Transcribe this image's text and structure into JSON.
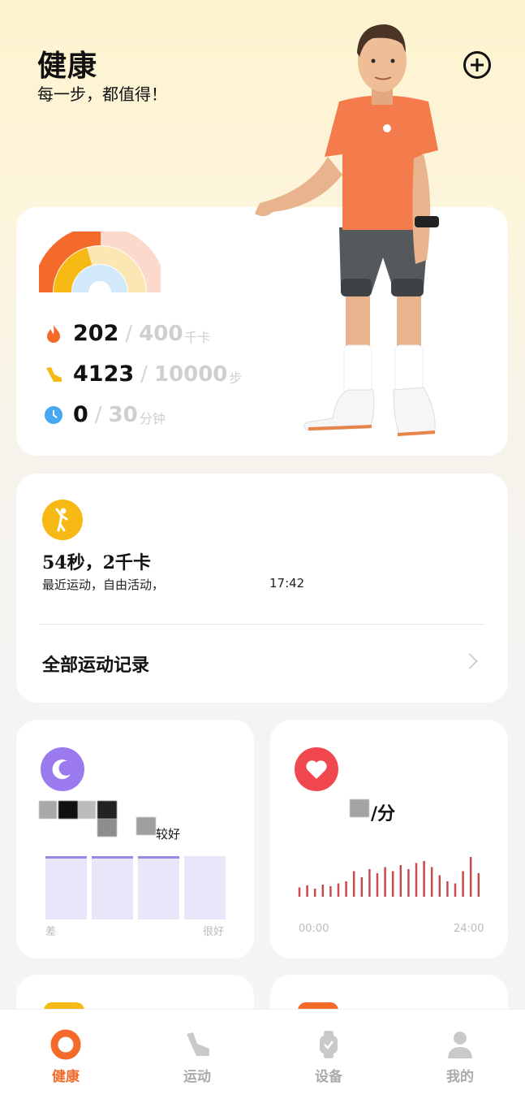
{
  "header": {
    "title": "健康",
    "subtitle": "每一步，都值得！"
  },
  "rings": {
    "calories": {
      "current": "202",
      "goal": "400",
      "unit": "千卡",
      "progress": 0.505,
      "color": "#f46a2b"
    },
    "steps": {
      "current": "4123",
      "goal": "10000",
      "unit": "步",
      "progress": 0.41,
      "color": "#f7b913"
    },
    "active": {
      "current": "0",
      "goal": "30",
      "unit": "分钟",
      "progress": 0,
      "color": "#46a8f0"
    },
    "separator": "/"
  },
  "workout": {
    "summary": "54秒，2千卡",
    "detail": "最近运动，自由活动，",
    "time": "17:42",
    "all_records": "全部运动记录"
  },
  "sleep": {
    "quality_text": "较好",
    "axis_left": "差",
    "axis_right": "很好",
    "bars_highlighted": [
      1,
      1,
      1,
      0
    ],
    "colors": {
      "icon": "#9b7af0",
      "bar": "#e9e6fa",
      "bar_top": "#9b87e6"
    }
  },
  "heart": {
    "unit_text": "/分",
    "axis_start": "00:00",
    "axis_end": "24:00",
    "samples": [
      0.15,
      0.2,
      0.12,
      0.22,
      0.18,
      0.25,
      0.3,
      0.55,
      0.4,
      0.6,
      0.5,
      0.65,
      0.55,
      0.7,
      0.6,
      0.75,
      0.8,
      0.65,
      0.45,
      0.3,
      0.25,
      0.55,
      0.9,
      0.5
    ],
    "colors": {
      "icon": "#f0484e",
      "line": "#c94a4a"
    }
  },
  "nav": {
    "items": [
      {
        "label": "健康",
        "icon": "health-ring-icon",
        "active": true
      },
      {
        "label": "运动",
        "icon": "shoe-icon",
        "active": false
      },
      {
        "label": "设备",
        "icon": "watch-icon",
        "active": false
      },
      {
        "label": "我的",
        "icon": "person-icon",
        "active": false
      }
    ]
  }
}
